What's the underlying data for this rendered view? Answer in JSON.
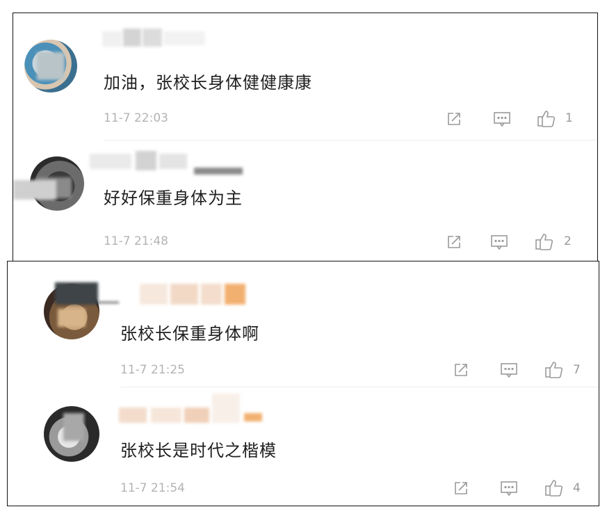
{
  "comments_top": [
    {
      "text": "加油，张校长身体健健康康",
      "time": "11-7 22:03",
      "likes": "1"
    },
    {
      "text": "好好保重身体为主",
      "time": "11-7 21:48",
      "likes": "2"
    }
  ],
  "comments_bottom": [
    {
      "text": "张校长保重身体啊",
      "time": "11-7 21:25",
      "likes": "7"
    },
    {
      "text": "张校长是时代之楷模",
      "time": "11-7 21:54",
      "likes": "4"
    }
  ],
  "icons": {
    "share": "share-icon",
    "comment": "comment-icon",
    "like": "thumbs-up-icon"
  },
  "colors": {
    "text": "#1f1f1f",
    "meta": "#b3b3b3",
    "icon": "#9a9a9a"
  }
}
